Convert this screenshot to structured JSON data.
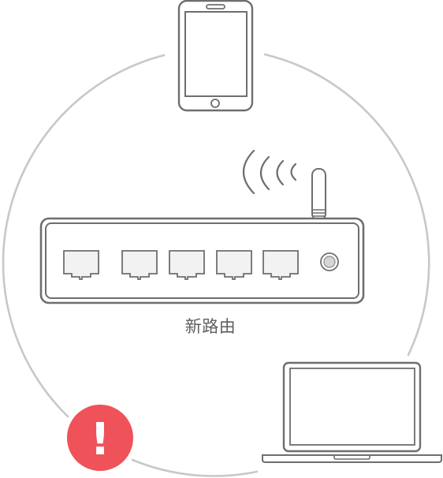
{
  "router": {
    "label": "新路由",
    "lan_port_count": 4,
    "wan_port_count": 1
  },
  "status": {
    "symbol": "!",
    "icon": "alert-icon",
    "color": "#f0525a"
  },
  "devices": {
    "phone_icon": "smartphone-icon",
    "laptop_icon": "laptop-icon",
    "wifi_icon": "wifi-signal-icon"
  },
  "colors": {
    "line": "#c8c8c8",
    "device_stroke": "#6e6e6e",
    "port_fill": "#f2f2f2"
  }
}
